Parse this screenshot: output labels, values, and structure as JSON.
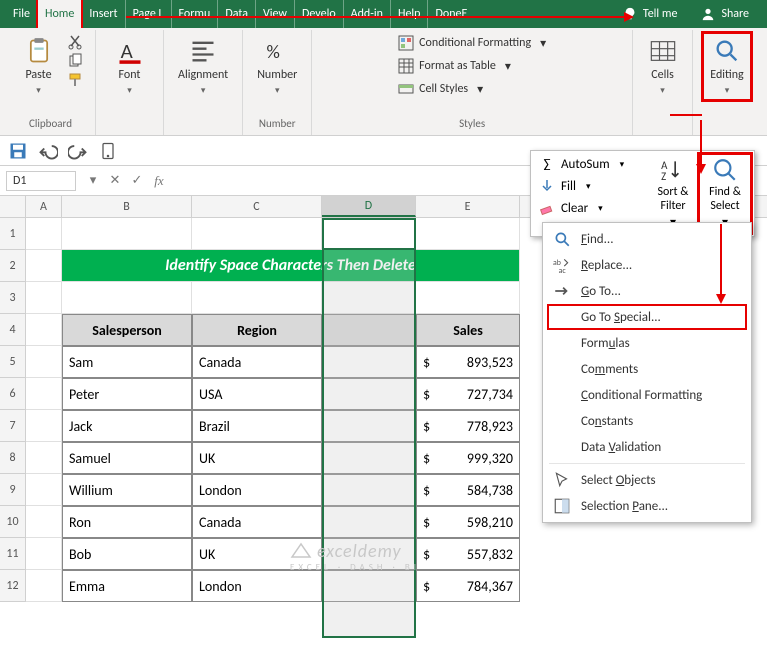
{
  "tabs": [
    "File",
    "Home",
    "Insert",
    "Page L",
    "Formu",
    "Data",
    "View",
    "Develo",
    "Add-in",
    "Help",
    "DoneE"
  ],
  "tellme": "Tell me",
  "share": "Share",
  "ribbon": {
    "paste": "Paste",
    "clipboard": "Clipboard",
    "font": "Font",
    "alignment": "Alignment",
    "number": "Number",
    "number_group": "Number",
    "styles_group": "Styles",
    "conditional_formatting": "Conditional Formatting",
    "format_as_table": "Format as Table",
    "cell_styles": "Cell Styles",
    "cells": "Cells",
    "editing": "Editing"
  },
  "namebox": "D1",
  "edit_panel": {
    "autosum": "AutoSum",
    "fill": "Fill",
    "clear": "Clear",
    "sort_filter": "Sort & Filter",
    "find_select": "Find & Select"
  },
  "submenu": {
    "find": "Find...",
    "replace": "Replace...",
    "goto": "Go To...",
    "goto_special": "Go To Special...",
    "formulas": "Formulas",
    "comments": "Comments",
    "cond_fmt": "Conditional Formatting",
    "constants": "Constants",
    "data_validation": "Data Validation",
    "select_objects": "Select Objects",
    "selection_pane": "Selection Pane..."
  },
  "col_headers": [
    "A",
    "B",
    "C",
    "D",
    "E"
  ],
  "row_headers": [
    "1",
    "2",
    "3",
    "4",
    "5",
    "6",
    "7",
    "8",
    "9",
    "10",
    "11",
    "12"
  ],
  "banner": "Identify Space Characters Then Delete",
  "table_headers": {
    "b": "Salesperson",
    "c": "Region",
    "d": "",
    "e": "Sales"
  },
  "rows": [
    {
      "sp": "Sam",
      "rg": "Canada",
      "sales": "893,523"
    },
    {
      "sp": "Peter",
      "rg": "USA",
      "sales": "727,734"
    },
    {
      "sp": "Jack",
      "rg": "Brazil",
      "sales": "778,923"
    },
    {
      "sp": "Samuel",
      "rg": "UK",
      "sales": "999,320"
    },
    {
      "sp": "Willium",
      "rg": "London",
      "sales": "584,738"
    },
    {
      "sp": "Ron",
      "rg": "Canada",
      "sales": "598,210"
    },
    {
      "sp": "Bob",
      "rg": "UK",
      "sales": "557,832"
    },
    {
      "sp": "Emma",
      "rg": "London",
      "sales": "784,367"
    }
  ],
  "watermark": {
    "main": "exceldemy",
    "sub": "EXCEL · DASH · BI"
  }
}
